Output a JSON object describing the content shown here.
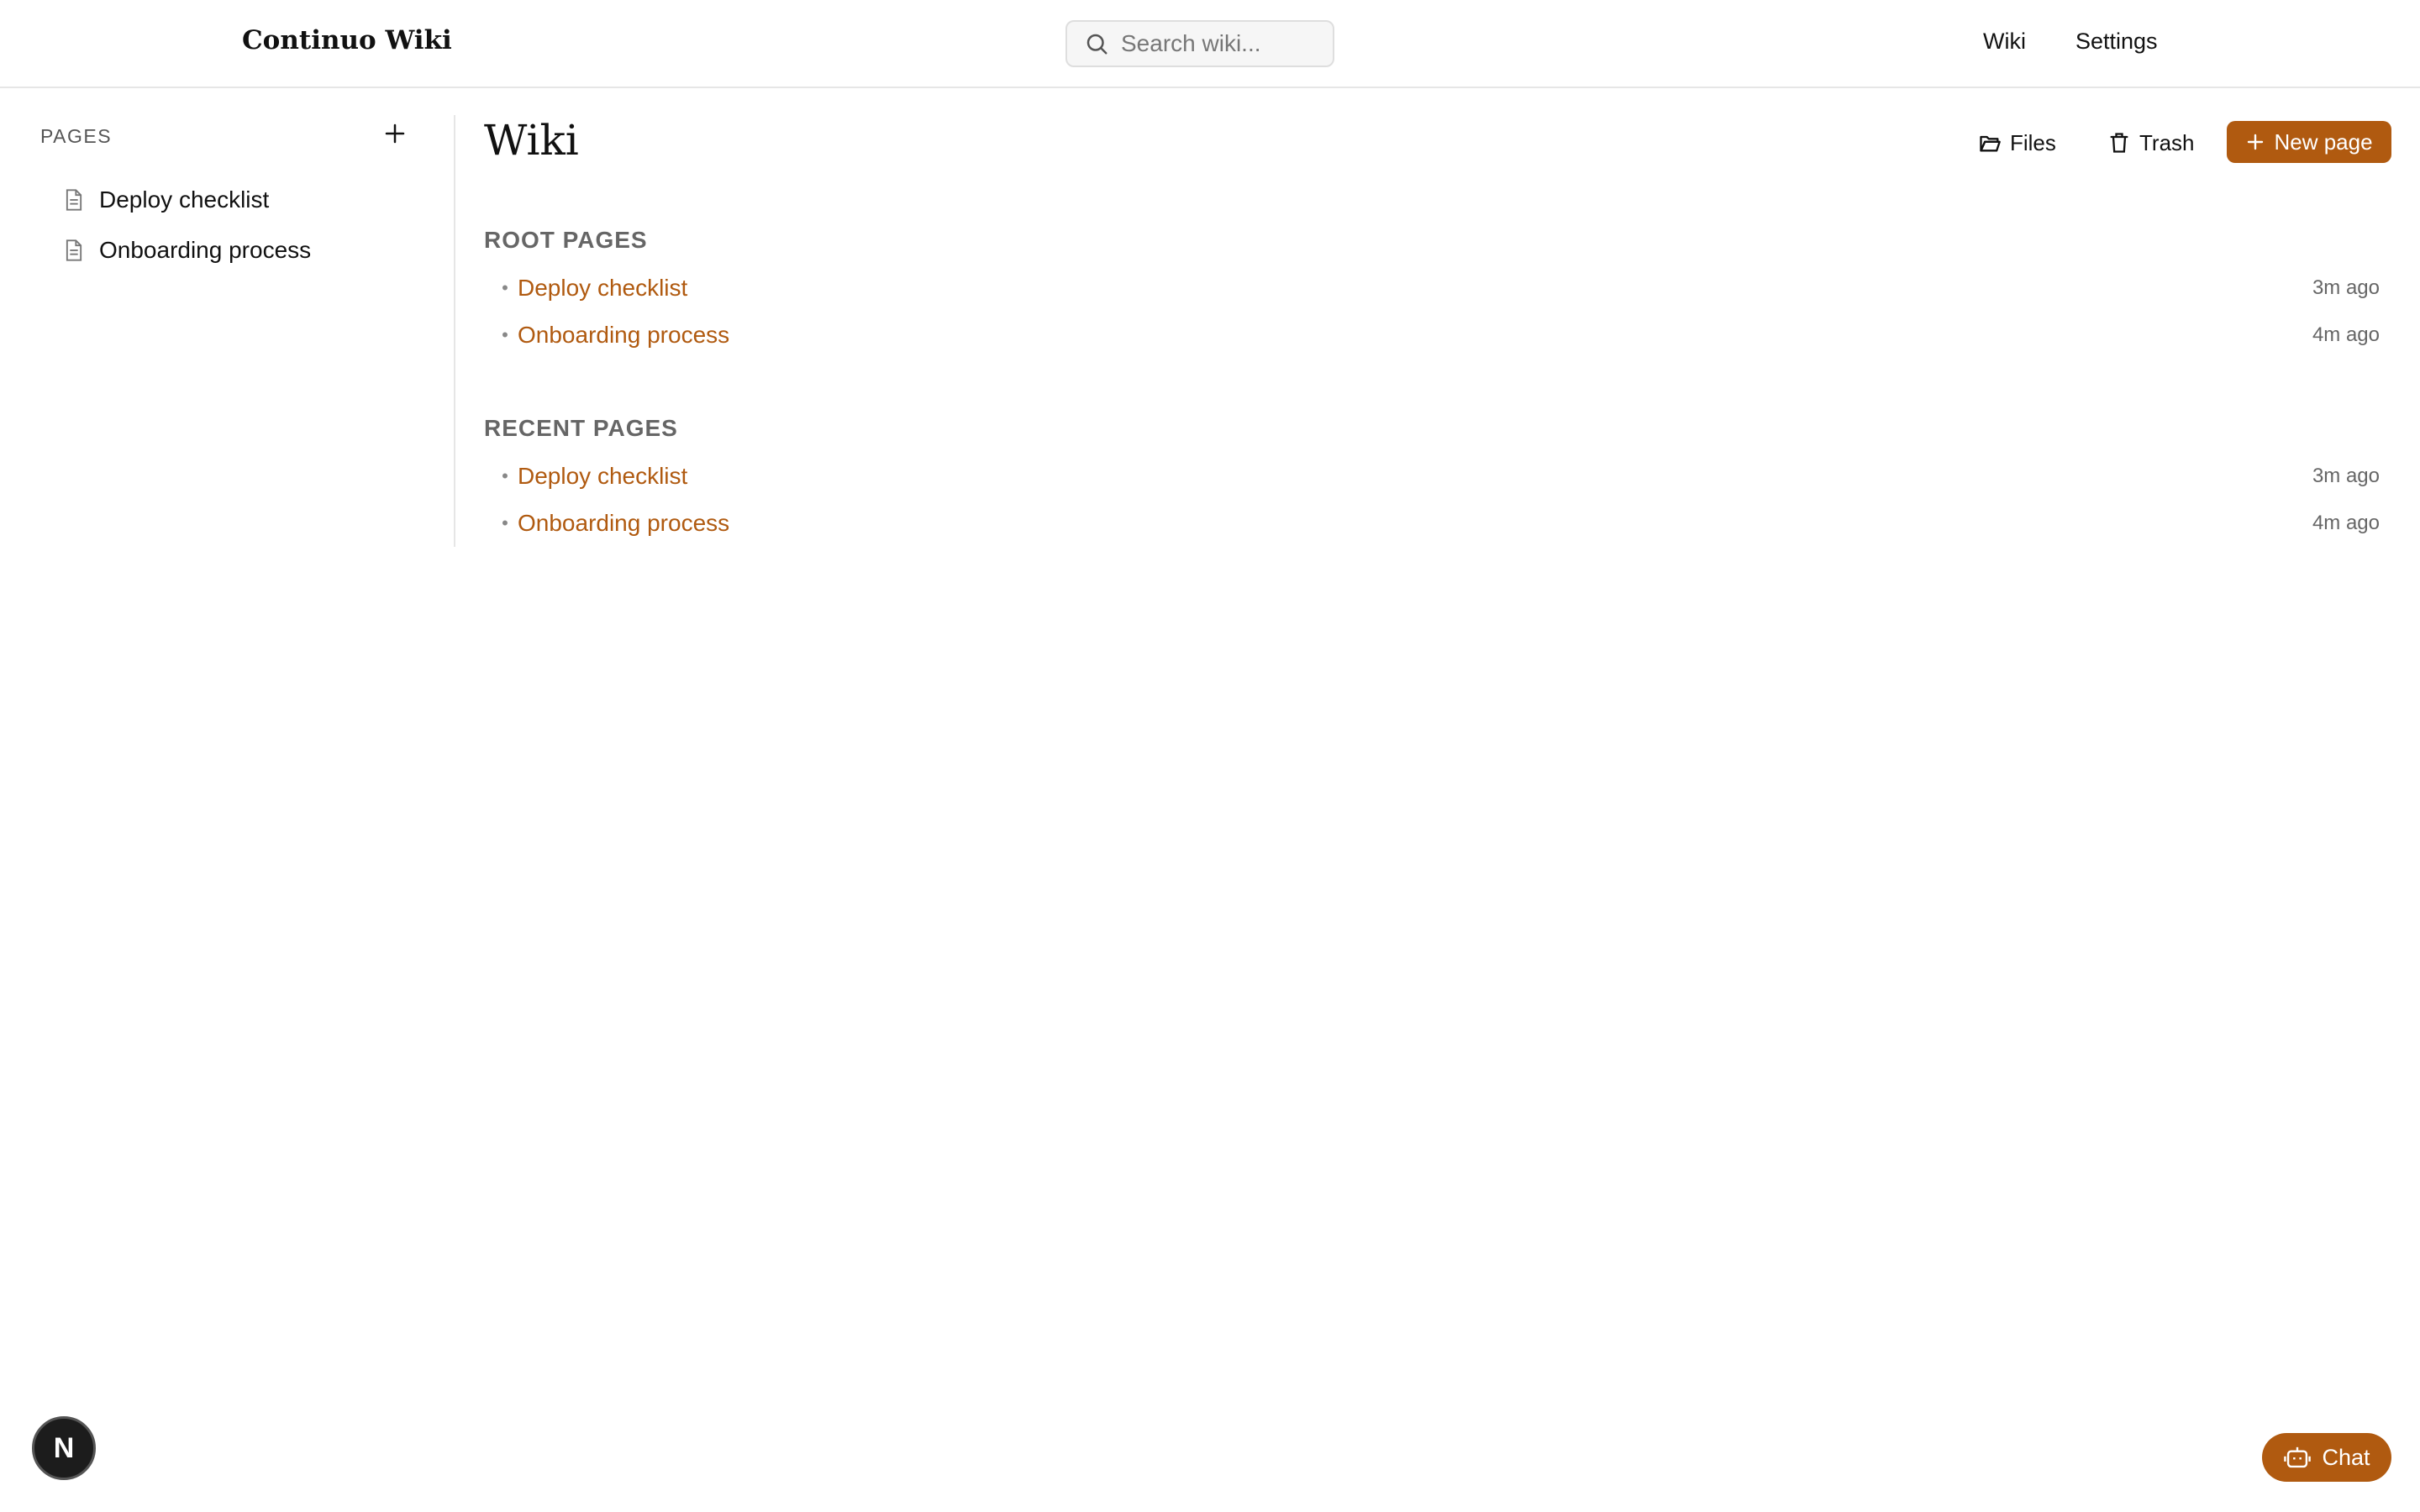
{
  "header": {
    "brand": "Continuo Wiki",
    "search_placeholder": "Search wiki...",
    "nav": [
      {
        "label": "Wiki"
      },
      {
        "label": "Settings"
      }
    ]
  },
  "sidebar": {
    "header": "PAGES",
    "items": [
      {
        "label": "Deploy checklist",
        "icon": "document-icon"
      },
      {
        "label": "Onboarding process",
        "icon": "document-icon"
      }
    ]
  },
  "main": {
    "title": "Wiki",
    "actions": {
      "files_label": "Files",
      "trash_label": "Trash",
      "new_page_label": "New page"
    },
    "sections": [
      {
        "label": "ROOT PAGES",
        "rows": [
          {
            "title": "Deploy checklist",
            "time": "3m ago"
          },
          {
            "title": "Onboarding process",
            "time": "4m ago"
          }
        ]
      },
      {
        "label": "RECENT PAGES",
        "rows": [
          {
            "title": "Deploy checklist",
            "time": "3m ago"
          },
          {
            "title": "Onboarding process",
            "time": "4m ago"
          }
        ]
      }
    ]
  },
  "footer": {
    "avatar_letter": "N",
    "chat_label": "Chat"
  },
  "colors": {
    "accent": "#b05a10",
    "text": "#111111",
    "muted": "#666666",
    "border": "#e6e6e6"
  }
}
